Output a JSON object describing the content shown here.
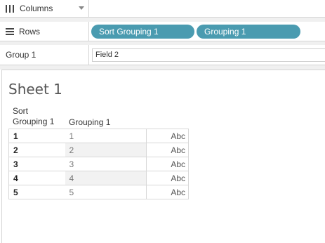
{
  "shelves": {
    "columns_label": "Columns",
    "rows_label": "Rows",
    "group_label": "Group 1"
  },
  "rows_pills": [
    "Sort Grouping 1",
    "Grouping 1"
  ],
  "field_value": "Field 2",
  "sheet_title": "Sheet 1",
  "table": {
    "headers": {
      "col1_line1": "Sort",
      "col1_line2": "Grouping 1",
      "col2": "Grouping 1"
    },
    "rows": [
      {
        "sort": "1",
        "grouping": "1",
        "value": "Abc"
      },
      {
        "sort": "2",
        "grouping": "2",
        "value": "Abc"
      },
      {
        "sort": "3",
        "grouping": "3",
        "value": "Abc"
      },
      {
        "sort": "4",
        "grouping": "4",
        "value": "Abc"
      },
      {
        "sort": "5",
        "grouping": "5",
        "value": "Abc"
      }
    ]
  },
  "colors": {
    "pill": "#4a9bb0"
  }
}
